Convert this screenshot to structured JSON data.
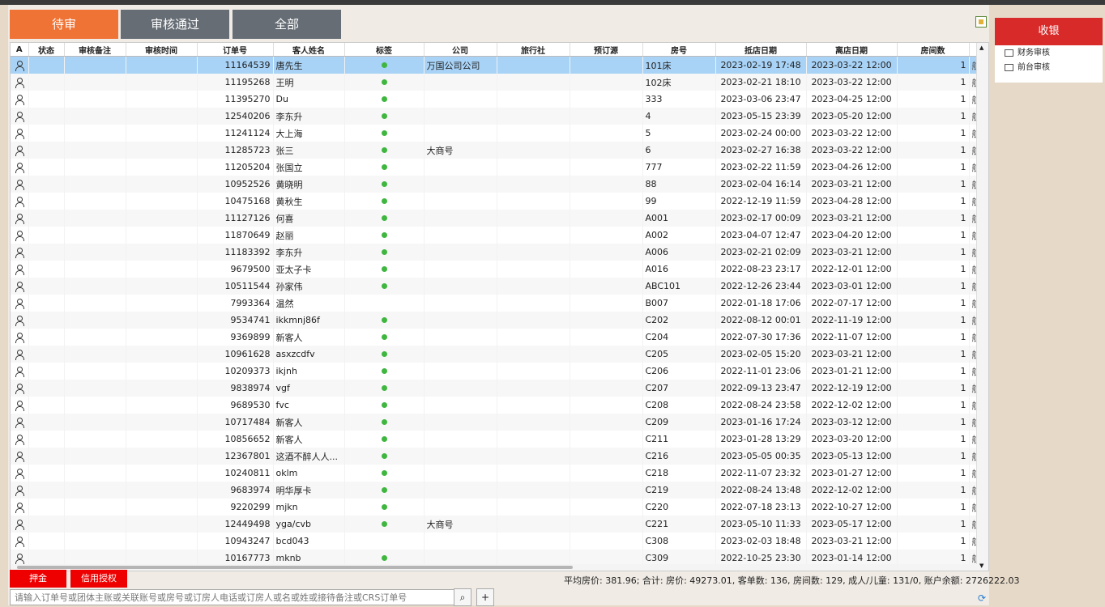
{
  "tabs": [
    {
      "label": "待审",
      "active": true
    },
    {
      "label": "审核通过",
      "active": false
    },
    {
      "label": "全部",
      "active": false
    }
  ],
  "columns": [
    "A",
    "状态",
    "审核备注",
    "审核时间",
    "订单号",
    "客人姓名",
    "标签",
    "公司",
    "旅行社",
    "预订源",
    "房号",
    "抵店日期",
    "离店日期",
    "房间数",
    ""
  ],
  "rows": [
    {
      "order": "11164539",
      "name": "唐先生",
      "tag": true,
      "company": "万国公司公司",
      "room": "101床",
      "arrive": "2023-02-19 17:48",
      "depart": "2023-03-22 12:00",
      "count": "1",
      "extra": "航"
    },
    {
      "order": "11195268",
      "name": "王明",
      "tag": true,
      "company": "",
      "room": "102床",
      "arrive": "2023-02-21 18:10",
      "depart": "2023-03-22 12:00",
      "count": "1",
      "extra": "航"
    },
    {
      "order": "11395270",
      "name": "Du",
      "tag": true,
      "company": "",
      "room": "333",
      "arrive": "2023-03-06 23:47",
      "depart": "2023-04-25 12:00",
      "count": "1",
      "extra": "航"
    },
    {
      "order": "12540206",
      "name": "李东升",
      "tag": true,
      "company": "",
      "room": "4",
      "arrive": "2023-05-15 23:39",
      "depart": "2023-05-20 12:00",
      "count": "1",
      "extra": "航"
    },
    {
      "order": "11241124",
      "name": "大上海",
      "tag": true,
      "company": "",
      "room": "5",
      "arrive": "2023-02-24 00:00",
      "depart": "2023-03-22 12:00",
      "count": "1",
      "extra": "航"
    },
    {
      "order": "11285723",
      "name": "张三",
      "tag": true,
      "company": "大商号",
      "room": "6",
      "arrive": "2023-02-27 16:38",
      "depart": "2023-03-22 12:00",
      "count": "1",
      "extra": "航"
    },
    {
      "order": "11205204",
      "name": "张国立",
      "tag": true,
      "company": "",
      "room": "777",
      "arrive": "2023-02-22 11:59",
      "depart": "2023-04-26 12:00",
      "count": "1",
      "extra": "航"
    },
    {
      "order": "10952526",
      "name": "黄晓明",
      "tag": true,
      "company": "",
      "room": "88",
      "arrive": "2023-02-04 16:14",
      "depart": "2023-03-21 12:00",
      "count": "1",
      "extra": "航"
    },
    {
      "order": "10475168",
      "name": "黄秋生",
      "tag": true,
      "company": "",
      "room": "99",
      "arrive": "2022-12-19 11:59",
      "depart": "2023-04-28 12:00",
      "count": "1",
      "extra": "航"
    },
    {
      "order": "11127126",
      "name": "何喜",
      "tag": true,
      "company": "",
      "room": "A001",
      "arrive": "2023-02-17 00:09",
      "depart": "2023-03-21 12:00",
      "count": "1",
      "extra": "航"
    },
    {
      "order": "11870649",
      "name": "赵丽",
      "tag": true,
      "company": "",
      "room": "A002",
      "arrive": "2023-04-07 12:47",
      "depart": "2023-04-20 12:00",
      "count": "1",
      "extra": "航"
    },
    {
      "order": "11183392",
      "name": "李东升",
      "tag": true,
      "company": "",
      "room": "A006",
      "arrive": "2023-02-21 02:09",
      "depart": "2023-03-21 12:00",
      "count": "1",
      "extra": "航"
    },
    {
      "order": "9679500",
      "name": "亚太子卡",
      "tag": true,
      "company": "",
      "room": "A016",
      "arrive": "2022-08-23 23:17",
      "depart": "2022-12-01 12:00",
      "count": "1",
      "extra": "航"
    },
    {
      "order": "10511544",
      "name": "孙家伟",
      "tag": true,
      "company": "",
      "room": "ABC101",
      "arrive": "2022-12-26 23:44",
      "depart": "2023-03-01 12:00",
      "count": "1",
      "extra": "航"
    },
    {
      "order": "7993364",
      "name": "温然",
      "tag": false,
      "company": "",
      "room": "B007",
      "arrive": "2022-01-18 17:06",
      "depart": "2022-07-17 12:00",
      "count": "1",
      "extra": "航"
    },
    {
      "order": "9534741",
      "name": "ikkmnj86f",
      "tag": true,
      "company": "",
      "room": "C202",
      "arrive": "2022-08-12 00:01",
      "depart": "2022-11-19 12:00",
      "count": "1",
      "extra": "航"
    },
    {
      "order": "9369899",
      "name": "新客人",
      "tag": true,
      "company": "",
      "room": "C204",
      "arrive": "2022-07-30 17:36",
      "depart": "2022-11-07 12:00",
      "count": "1",
      "extra": "航"
    },
    {
      "order": "10961628",
      "name": "asxzcdfv",
      "tag": true,
      "company": "",
      "room": "C205",
      "arrive": "2023-02-05 15:20",
      "depart": "2023-03-21 12:00",
      "count": "1",
      "extra": "航"
    },
    {
      "order": "10209373",
      "name": "ikjnh",
      "tag": true,
      "company": "",
      "room": "C206",
      "arrive": "2022-11-01 23:06",
      "depart": "2023-01-21 12:00",
      "count": "1",
      "extra": "航"
    },
    {
      "order": "9838974",
      "name": "vgf",
      "tag": true,
      "company": "",
      "room": "C207",
      "arrive": "2022-09-13 23:47",
      "depart": "2022-12-19 12:00",
      "count": "1",
      "extra": "航"
    },
    {
      "order": "9689530",
      "name": "fvc",
      "tag": true,
      "company": "",
      "room": "C208",
      "arrive": "2022-08-24 23:58",
      "depart": "2022-12-02 12:00",
      "count": "1",
      "extra": "航"
    },
    {
      "order": "10717484",
      "name": "新客人",
      "tag": true,
      "company": "",
      "room": "C209",
      "arrive": "2023-01-16 17:24",
      "depart": "2023-03-12 12:00",
      "count": "1",
      "extra": "航"
    },
    {
      "order": "10856652",
      "name": "新客人",
      "tag": true,
      "company": "",
      "room": "C211",
      "arrive": "2023-01-28 13:29",
      "depart": "2023-03-20 12:00",
      "count": "1",
      "extra": "航"
    },
    {
      "order": "12367801",
      "name": "这酒不醉人人...",
      "tag": true,
      "company": "",
      "room": "C216",
      "arrive": "2023-05-05 00:35",
      "depart": "2023-05-13 12:00",
      "count": "1",
      "extra": "航"
    },
    {
      "order": "10240811",
      "name": "oklm",
      "tag": true,
      "company": "",
      "room": "C218",
      "arrive": "2022-11-07 23:32",
      "depart": "2023-01-27 12:00",
      "count": "1",
      "extra": "航"
    },
    {
      "order": "9683974",
      "name": "明华厚卡",
      "tag": true,
      "company": "",
      "room": "C219",
      "arrive": "2022-08-24 13:48",
      "depart": "2022-12-02 12:00",
      "count": "1",
      "extra": "航"
    },
    {
      "order": "9220299",
      "name": "mjkn",
      "tag": true,
      "company": "",
      "room": "C220",
      "arrive": "2022-07-18 23:13",
      "depart": "2022-10-27 12:00",
      "count": "1",
      "extra": "航"
    },
    {
      "order": "12449498",
      "name": "yga/cvb",
      "tag": true,
      "company": "大商号",
      "room": "C221",
      "arrive": "2023-05-10 11:33",
      "depart": "2023-05-17 12:00",
      "count": "1",
      "extra": "航"
    },
    {
      "order": "10943247",
      "name": "bcd043",
      "tag": false,
      "company": "",
      "room": "C308",
      "arrive": "2023-02-03 18:48",
      "depart": "2023-03-21 12:00",
      "count": "1",
      "extra": "航"
    },
    {
      "order": "10167773",
      "name": "mknb",
      "tag": true,
      "company": "",
      "room": "C309",
      "arrive": "2022-10-25 23:30",
      "depart": "2023-01-14 12:00",
      "count": "1",
      "extra": "航"
    }
  ],
  "buttons": {
    "deposit": "押金",
    "credit": "信用授权"
  },
  "summary": "平均房价: 381.96; 合计: 房价: 49273.01, 客单数: 136, 房间数: 129, 成人/儿童: 131/0, 账户余额: 2726222.03",
  "search": {
    "placeholder": "请输入订单号或团体主账或关联账号或房号或订房人电话或订房人或名或姓或接待备注或CRS订单号",
    "value": ""
  },
  "icons": {
    "search": "search-icon",
    "add": "add-icon",
    "refresh": "refresh-icon",
    "person": "person-icon"
  },
  "right_panel": {
    "header": "收银",
    "items": [
      "财务审核",
      "前台审核"
    ]
  },
  "colors": {
    "active_tab": "#f07336",
    "inactive_tab": "#666d75",
    "selected_row": "#a8d3f7",
    "red": "#ee0000",
    "tag_dot": "#3fb63f"
  }
}
